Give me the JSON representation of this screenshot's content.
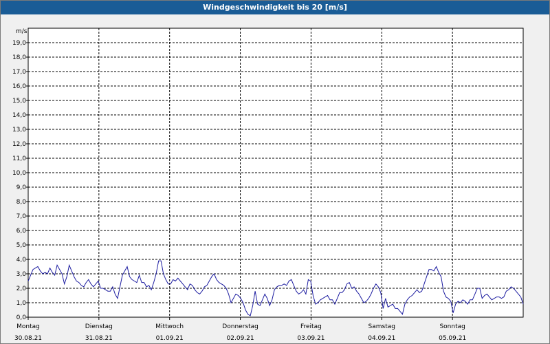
{
  "window": {
    "title": "Windgeschwindigkeit bis 20 [m/s]"
  },
  "chart_data": {
    "type": "line",
    "title": "Windgeschwindigkeit bis 20 [m/s]",
    "ylabel": "m/s",
    "xlabel": "",
    "ylim": [
      0,
      20
    ],
    "xlim": [
      0,
      7
    ],
    "grid": true,
    "y_ticks": [
      "0,0",
      "1,0",
      "2,0",
      "3,0",
      "4,0",
      "5,0",
      "6,0",
      "7,0",
      "8,0",
      "9,0",
      "10,0",
      "11,0",
      "12,0",
      "13,0",
      "14,0",
      "15,0",
      "16,0",
      "17,0",
      "18,0",
      "19,0"
    ],
    "x_ticks": [
      {
        "day": "Montag",
        "date": "30.08.21"
      },
      {
        "day": "Dienstag",
        "date": "31.08.21"
      },
      {
        "day": "Mittwoch",
        "date": "01.09.21"
      },
      {
        "day": "Donnerstag",
        "date": "02.09.21"
      },
      {
        "day": "Freitag",
        "date": "03.09.21"
      },
      {
        "day": "Samstag",
        "date": "04.09.21"
      },
      {
        "day": "Sonntag",
        "date": "05.09.21"
      }
    ],
    "colors": {
      "line": "#1c1ca0",
      "plot_bg": "#ffffff",
      "grid": "#000000"
    },
    "series": [
      {
        "values": [
          2.5,
          2.9,
          3.3,
          3.4,
          3.5,
          3.2,
          3.0,
          3.1,
          3.0,
          3.4,
          3.1,
          2.9,
          3.6,
          3.3,
          3.0,
          2.3,
          2.8,
          3.6,
          3.2,
          2.8,
          2.5,
          2.4,
          2.2,
          2.1,
          2.4,
          2.6,
          2.3,
          2.1,
          2.3,
          2.5,
          2.0,
          2.0,
          1.9,
          1.8,
          1.8,
          2.1,
          1.6,
          1.3,
          2.1,
          2.9,
          3.2,
          3.5,
          2.8,
          2.6,
          2.5,
          2.4,
          2.9,
          2.4,
          2.4,
          2.1,
          2.2,
          1.9,
          2.4,
          3.0,
          3.9,
          3.9,
          3.0,
          2.6,
          2.3,
          2.3,
          2.6,
          2.5,
          2.7,
          2.5,
          2.3,
          2.1,
          1.9,
          2.3,
          2.2,
          1.9,
          1.7,
          1.6,
          1.8,
          2.1,
          2.2,
          2.5,
          2.8,
          3.0,
          2.6,
          2.4,
          2.3,
          2.2,
          2.0,
          1.6,
          1.0,
          1.3,
          1.6,
          1.5,
          1.3,
          1.0,
          0.5,
          0.2,
          0.1,
          0.8,
          1.8,
          0.9,
          0.8,
          1.2,
          1.6,
          1.3,
          0.8,
          1.2,
          1.9,
          2.1,
          2.2,
          2.2,
          2.3,
          2.2,
          2.5,
          2.6,
          2.2,
          1.8,
          1.6,
          1.7,
          1.9,
          1.6,
          2.6,
          2.5,
          1.5,
          0.9,
          1.0,
          1.2,
          1.3,
          1.4,
          1.5,
          1.2,
          1.2,
          0.9,
          1.3,
          1.7,
          1.7,
          1.9,
          2.3,
          2.4,
          2.0,
          2.1,
          1.8,
          1.6,
          1.3,
          1.0,
          1.1,
          1.3,
          1.6,
          2.0,
          2.3,
          2.1,
          1.7,
          0.6,
          1.3,
          0.7,
          0.8,
          0.9,
          0.6,
          0.6,
          0.4,
          0.2,
          0.9,
          1.2,
          1.4,
          1.5,
          1.7,
          1.9,
          1.7,
          1.8,
          2.3,
          2.8,
          3.3,
          3.3,
          3.2,
          3.5,
          3.1,
          2.8,
          1.8,
          1.4,
          1.3,
          1.1,
          0.3,
          0.9,
          1.1,
          1.0,
          1.2,
          1.1,
          0.9,
          1.2,
          1.2,
          1.6,
          2.0,
          2.0,
          1.3,
          1.5,
          1.6,
          1.4,
          1.2,
          1.3,
          1.4,
          1.4,
          1.3,
          1.4,
          1.8,
          1.9,
          2.1,
          2.0,
          1.8,
          1.6,
          1.4,
          0.9
        ]
      }
    ]
  }
}
